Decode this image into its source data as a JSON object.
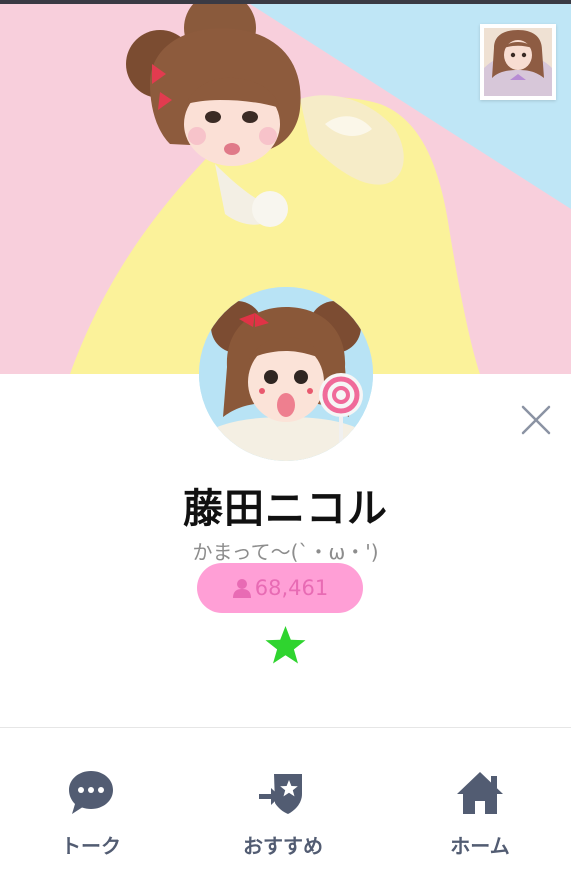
{
  "profile": {
    "name": "藤田ニコル",
    "status_message": "かまって〜(`・ω・')",
    "friends_count": "68,461",
    "friends_icon": "person-icon",
    "favorite_icon": "star-icon"
  },
  "header": {
    "close_icon": "close-icon"
  },
  "tabbar": {
    "items": [
      {
        "label": "トーク",
        "icon": "chat-bubble-icon"
      },
      {
        "label": "おすすめ",
        "icon": "recommend-badge-icon"
      },
      {
        "label": "ホーム",
        "icon": "home-icon"
      }
    ]
  },
  "colors": {
    "pill_background": "#ff9fd6",
    "pill_text": "#e86bb4",
    "star": "#2fd42f",
    "tab_icon": "#525c72"
  }
}
